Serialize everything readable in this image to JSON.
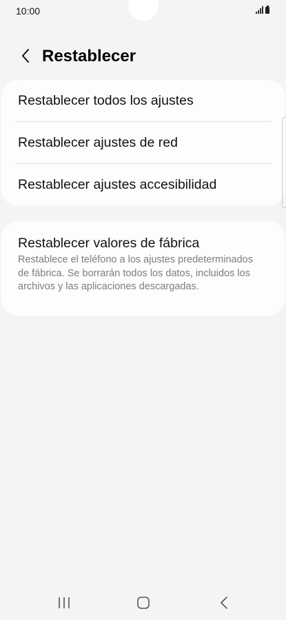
{
  "status_bar": {
    "time": "10:00",
    "signal_icon": "signal-icon",
    "battery_icon": "battery-icon"
  },
  "header": {
    "back_icon": "chevron-left-icon",
    "title": "Restablecer"
  },
  "reset_options": [
    {
      "label": "Restablecer todos los ajustes"
    },
    {
      "label": "Restablecer ajustes de red"
    },
    {
      "label": "Restablecer ajustes accesibilidad"
    }
  ],
  "factory_reset": {
    "title": "Restablecer valores de fábrica",
    "description": "Restablece el teléfono a los ajustes predeterminados de fábrica. Se borrarán todos los datos, incluidos los archivos y las aplicaciones descargadas."
  },
  "nav_bar": {
    "recents_icon": "recents-icon",
    "home_icon": "home-icon",
    "back_icon": "back-icon"
  }
}
